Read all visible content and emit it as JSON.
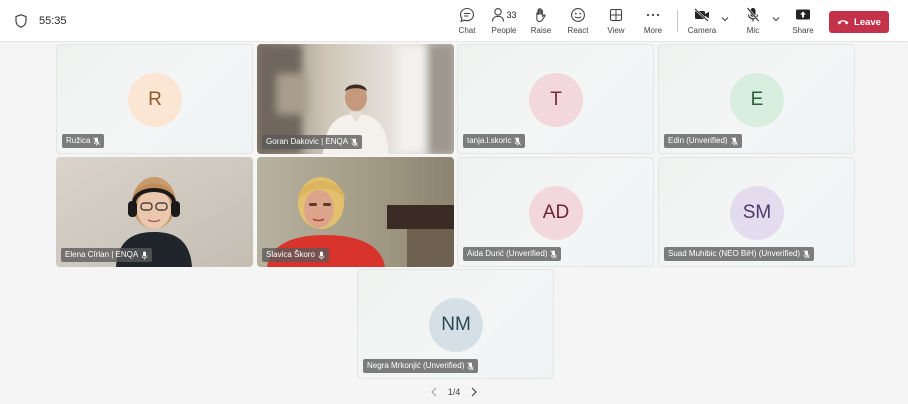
{
  "meeting": {
    "timer": "55:35"
  },
  "toolbar": {
    "chat": "Chat",
    "people": "People",
    "people_count": "33",
    "raise": "Raise",
    "react": "React",
    "view": "View",
    "more": "More",
    "camera": "Camera",
    "mic": "Mic",
    "share": "Share",
    "leave": "Leave"
  },
  "participants": [
    {
      "name": "Ružica",
      "initials": "R",
      "avatar_bg": "#fbe6d4",
      "avatar_fg": "#8a5a2b",
      "video": false
    },
    {
      "name": "Goran Dakovic | ENQA",
      "initials": "",
      "video": true
    },
    {
      "name": "tanja.l.skoric",
      "initials": "T",
      "avatar_bg": "#f2d8dc",
      "avatar_fg": "#7a2b36",
      "video": false
    },
    {
      "name": "Edin (Unverified)",
      "initials": "E",
      "avatar_bg": "#d8eedf",
      "avatar_fg": "#2c5d3b",
      "video": false
    },
    {
      "name": "Elena Cîrlan | ENQA",
      "initials": "",
      "video": true
    },
    {
      "name": "Slavica Škoro",
      "initials": "",
      "video": true
    },
    {
      "name": "Aida Durić (Unverified)",
      "initials": "AD",
      "avatar_bg": "#f2d8dc",
      "avatar_fg": "#6e2430",
      "video": false
    },
    {
      "name": "Suad Muhibic (NEO BiH) (Unverified)",
      "initials": "SM",
      "avatar_bg": "#e3dcef",
      "avatar_fg": "#4a3a6b",
      "video": false
    },
    {
      "name": "Negra Mrkonjić (Unverified)",
      "initials": "NM",
      "avatar_bg": "#d5e0e6",
      "avatar_fg": "#2d4756",
      "video": false
    }
  ],
  "pager": {
    "label": "1/4"
  },
  "colors": {
    "leave_button": "#c4314b"
  }
}
